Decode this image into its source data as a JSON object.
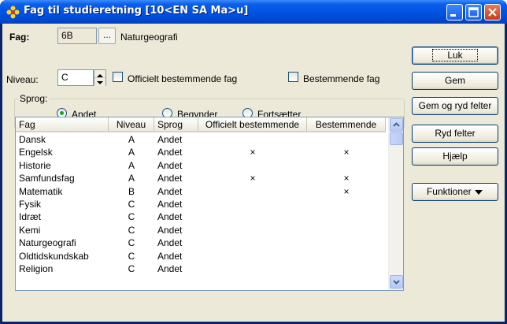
{
  "window": {
    "title": "Fag til studieretning [10<EN SA Ma>u]",
    "icon": "flower-icon"
  },
  "form": {
    "fag_label": "Fag:",
    "fag_code": "6B",
    "dots_label": "...",
    "fag_name": "Naturgeografi",
    "niveau_label": "Niveau:",
    "niveau_value": "C",
    "officielt_label": "Officielt bestemmende fag",
    "officielt_checked": false,
    "bestemmende_label": "Bestemmende fag",
    "bestemmende_checked": false
  },
  "sprog": {
    "group_label": "Sprog:",
    "options": [
      "Andet",
      "Begynder",
      "Fortsætter"
    ],
    "selected": "Andet"
  },
  "table": {
    "columns": [
      "Fag",
      "Niveau",
      "Sprog",
      "Officielt bestemmende",
      "Bestemmende"
    ],
    "rows": [
      [
        "Dansk",
        "A",
        "Andet",
        "",
        ""
      ],
      [
        "Engelsk",
        "A",
        "Andet",
        "×",
        "×"
      ],
      [
        "Historie",
        "A",
        "Andet",
        "",
        ""
      ],
      [
        "Samfundsfag",
        "A",
        "Andet",
        "×",
        "×"
      ],
      [
        "Matematik",
        "B",
        "Andet",
        "",
        "×"
      ],
      [
        "Fysik",
        "C",
        "Andet",
        "",
        ""
      ],
      [
        "Idræt",
        "C",
        "Andet",
        "",
        ""
      ],
      [
        "Kemi",
        "C",
        "Andet",
        "",
        ""
      ],
      [
        "Naturgeografi",
        "C",
        "Andet",
        "",
        ""
      ],
      [
        "Oldtidskundskab",
        "C",
        "Andet",
        "",
        ""
      ],
      [
        "Religion",
        "C",
        "Andet",
        "",
        ""
      ]
    ]
  },
  "buttons": {
    "luk": "Luk",
    "gem": "Gem",
    "gem_ryd": "Gem og ryd felter",
    "ryd": "Ryd felter",
    "hjaelp": "Hjælp",
    "funktioner": "Funktioner"
  },
  "colors": {
    "titlebar": "#0054e3",
    "client": "#ece9d8",
    "radio_dot": "#21a121"
  }
}
